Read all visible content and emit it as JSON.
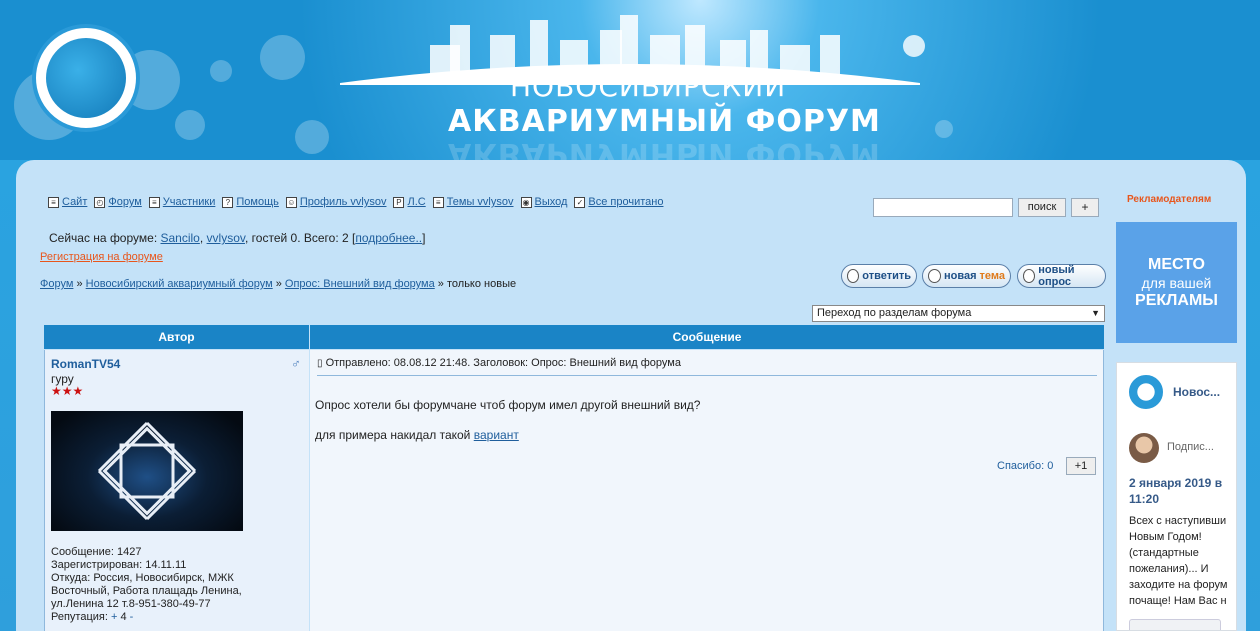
{
  "header": {
    "title_line1": "НОВОСИБИРСКИЙ",
    "title_line2": "АКВАРИУМНЫЙ ФОРУМ"
  },
  "nav": [
    {
      "icon": "site-icon",
      "label": "Сайт"
    },
    {
      "icon": "forum-icon",
      "label": "Форум"
    },
    {
      "icon": "members-icon",
      "label": "Участники"
    },
    {
      "icon": "help-icon",
      "label": "Помощь"
    },
    {
      "icon": "profile-icon",
      "label": "Профиль vvlysov"
    },
    {
      "icon": "pm-icon",
      "label": "Л.С"
    },
    {
      "icon": "topics-icon",
      "label": "Темы vvlysov"
    },
    {
      "icon": "logout-icon",
      "label": "Выход"
    },
    {
      "icon": "checkmark-icon",
      "label": "Все прочитано"
    }
  ],
  "search": {
    "button": "поиск",
    "plus": "+",
    "value": ""
  },
  "online": {
    "prefix": "Сейчас на форуме:",
    "user1": "Sancilo",
    "sep": ",",
    "user2": "vvlysov",
    "suffix": ", гостей 0. Всего: 2 [",
    "more": "подробнее..",
    "close": "]"
  },
  "register_link": "Регистрация на форуме",
  "breadcrumb": {
    "item1": "Форум",
    "sep": " » ",
    "item2": "Новосибирский аквариумный форум",
    "item3": "Опрос: Внешний вид форума",
    "current": "только новые"
  },
  "actions": {
    "reply": "ответить",
    "new_topic_a": "новая",
    "new_topic_b": "тема",
    "new_poll": "новый опрос"
  },
  "jump_select": "Переход по разделам форума",
  "table": {
    "col_author": "Автор",
    "col_message": "Сообщение"
  },
  "post": {
    "author": "RomanTV54",
    "rank": "гуру",
    "stars": "★★★",
    "info": [
      "Сообщение: 1427",
      "Зарегистрирован: 14.11.11",
      "Откуда: Россия, Новосибирск, МЖК",
      "Восточный, Работа плащадь Ленина,",
      "ул.Ленина 12 т.8-951-380-49-77"
    ],
    "reputation_label": "Репутация:",
    "reputation_plus": "+",
    "reputation_value": "4",
    "reputation_minus": "-",
    "header": "Отправлено: 08.08.12 21:48. Заголовок: Опрос: Внешний вид форума",
    "body_line1": "Опрос хотели бы форумчане чтоб форум имел другой внешний вид?",
    "body_line2_text": "для примера накидал такой",
    "body_line2_link": "вариант",
    "thanks": "Спасибо: 0",
    "plus_one": "+1"
  },
  "sidebar": {
    "advertisers": "Рекламодателям",
    "ad_line1": "МЕСТО",
    "ad_line2": "для вашей",
    "ad_line3": "РЕКЛАМЫ",
    "fb_name": "Новос...",
    "fb_subscribe": "Подпис...",
    "fb_date": "2 января 2019 в 11:20",
    "fb_text": [
      "Всех с наступивши",
      "Новым Годом!",
      "(стандартные",
      "пожелания)... И",
      "заходите на форум",
      "почаще! Нам Вас н"
    ]
  }
}
